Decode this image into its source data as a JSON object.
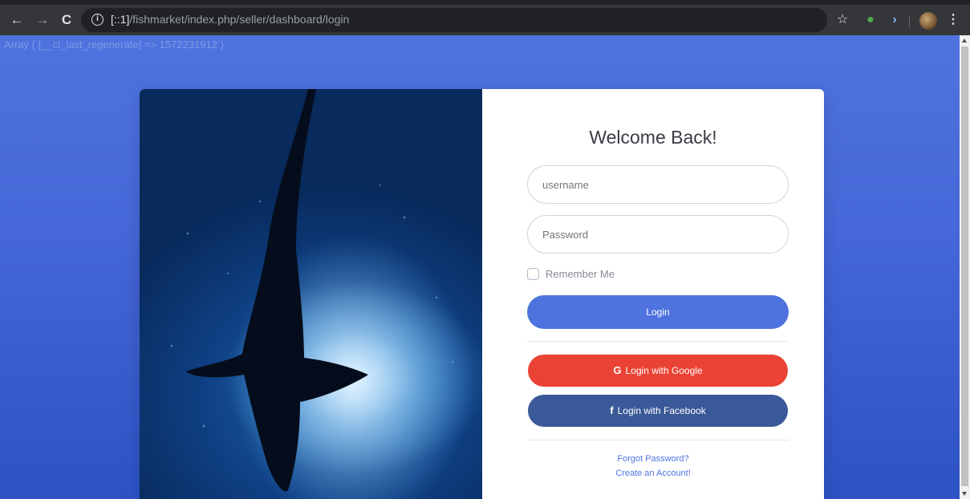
{
  "browser": {
    "url_host": "[::1]",
    "url_path": "/fishmarket/index.php/seller/dashboard/login",
    "nav_back": "←",
    "nav_forward": "→",
    "reload": "C",
    "info_glyph": "i",
    "star_glyph": "☆",
    "ext_glyph": "●",
    "ext_arrow_glyph": "›",
    "menu_glyph": "⋮"
  },
  "page": {
    "debug_text": "Array ( [__ci_last_regenerate] => 1572231912 )"
  },
  "login_form": {
    "title": "Welcome Back!",
    "username_placeholder": "username",
    "password_placeholder": "Password",
    "remember_label": "Remember Me",
    "login_button": "Login",
    "google_icon": "G",
    "google_button": "Login with Google",
    "facebook_icon": "f",
    "facebook_button": "Login with Facebook",
    "forgot_link": "Forgot Password?",
    "create_link": "Create an Account!"
  },
  "colors": {
    "primary": "#4e73df",
    "google": "#ea4335",
    "facebook": "#3b5998",
    "text_dark": "#3a3b45"
  }
}
